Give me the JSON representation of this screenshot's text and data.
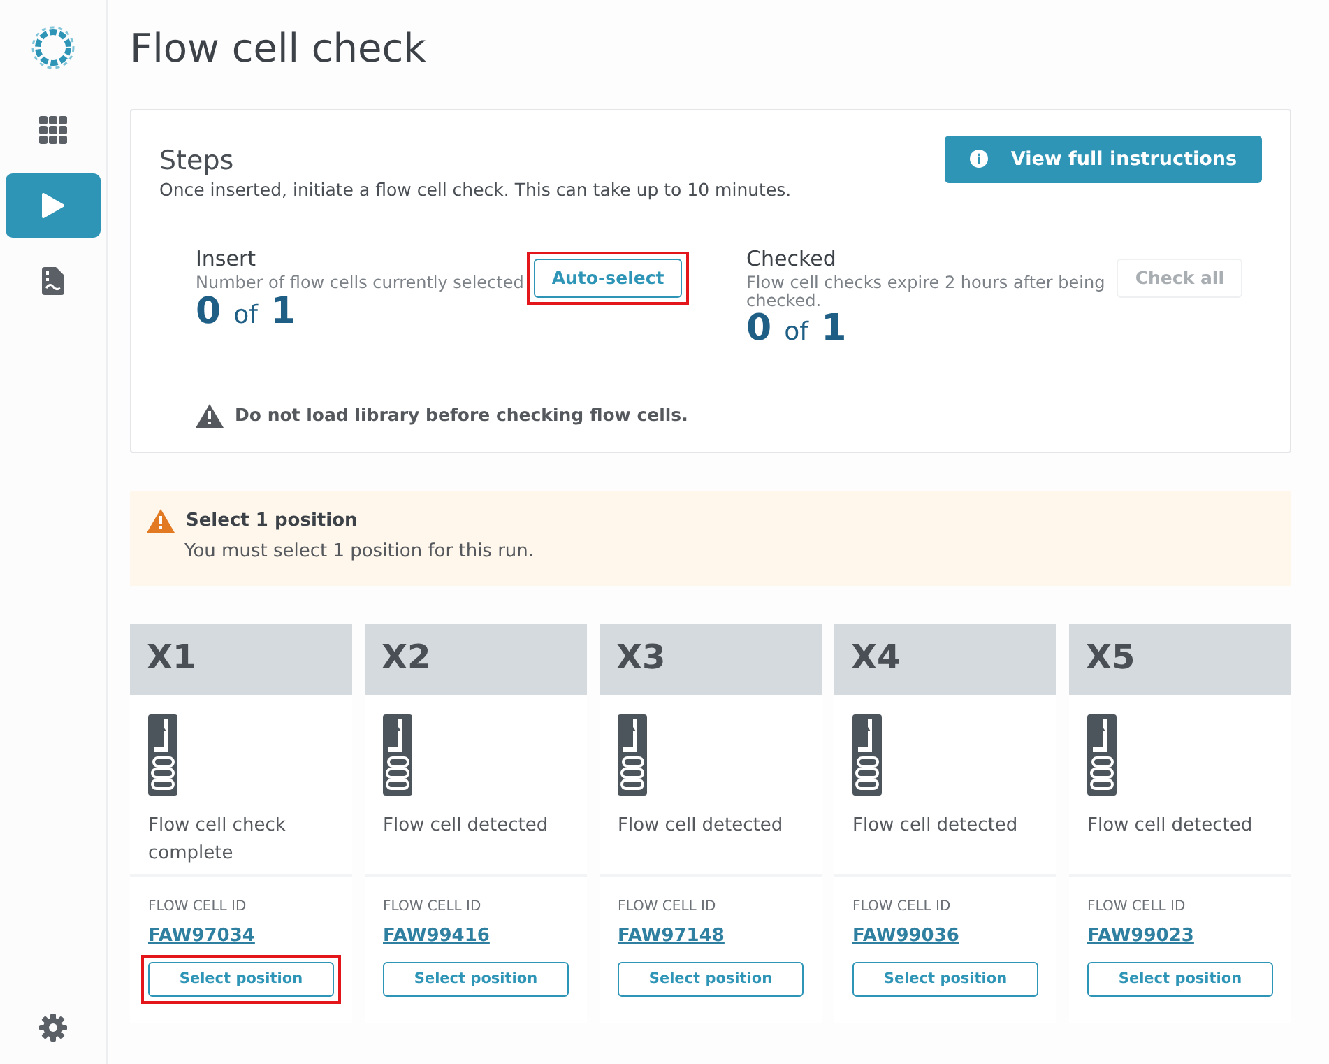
{
  "sidebar": {
    "items": [
      {
        "kind": "grid",
        "selected": false
      },
      {
        "kind": "play",
        "selected": true
      },
      {
        "kind": "report",
        "selected": false
      }
    ]
  },
  "page_title": "Flow cell check",
  "steps": {
    "title": "Steps",
    "instructions_button": "View full instructions",
    "description": "Once inserted, initiate a flow cell check. This can take up to 10 minutes.",
    "insert": {
      "title": "Insert",
      "subtitle": "Number of flow cells currently selected",
      "count": "0",
      "of": "of",
      "total": "1",
      "button": "Auto-select",
      "button_disabled": false,
      "highlighted": true
    },
    "checked": {
      "title": "Checked",
      "subtitle": "Flow cell checks expire 2 hours after being checked.",
      "count": "0",
      "of": "of",
      "total": "1",
      "button": "Check all",
      "button_disabled": true,
      "highlighted": false
    },
    "warning": "Do not load library before checking flow cells."
  },
  "alert": {
    "title": "Select 1 position",
    "message": "You must select 1 position for this run."
  },
  "positions": [
    {
      "label": "X1",
      "status": "Flow cell check complete",
      "id_label": "FLOW CELL ID",
      "flow_cell_id": "FAW97034",
      "button": "Select position",
      "highlighted": true
    },
    {
      "label": "X2",
      "status": "Flow cell detected",
      "id_label": "FLOW CELL ID",
      "flow_cell_id": "FAW99416",
      "button": "Select position",
      "highlighted": false
    },
    {
      "label": "X3",
      "status": "Flow cell detected",
      "id_label": "FLOW CELL ID",
      "flow_cell_id": "FAW97148",
      "button": "Select position",
      "highlighted": false
    },
    {
      "label": "X4",
      "status": "Flow cell detected",
      "id_label": "FLOW CELL ID",
      "flow_cell_id": "FAW99036",
      "button": "Select position",
      "highlighted": false
    },
    {
      "label": "X5",
      "status": "Flow cell detected",
      "id_label": "FLOW CELL ID",
      "flow_cell_id": "FAW99023",
      "button": "Select position",
      "highlighted": false
    }
  ]
}
